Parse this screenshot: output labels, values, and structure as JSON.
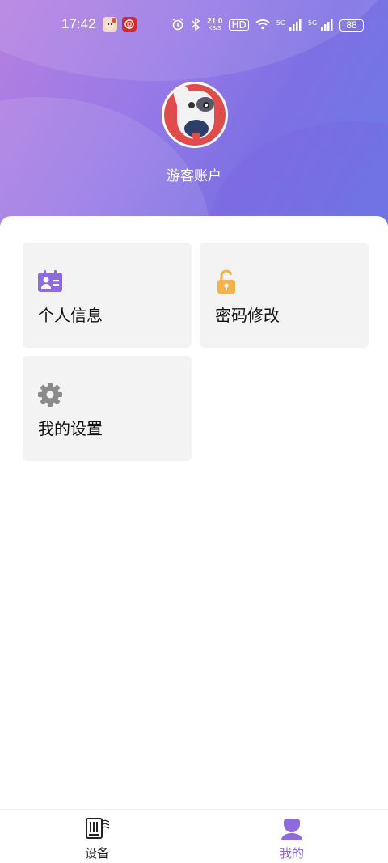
{
  "status_bar": {
    "time": "17:42",
    "net_speed_value": "21.0",
    "net_speed_unit": "KB/S",
    "hd_label": "HD",
    "signal1_label": "5G",
    "signal2_label": "5G",
    "battery": "88"
  },
  "profile": {
    "username": "游客账户"
  },
  "menu": {
    "personal_info": "个人信息",
    "change_password": "密码修改",
    "my_settings": "我的设置"
  },
  "tabbar": {
    "devices": "设备",
    "mine": "我的"
  },
  "colors": {
    "accent": "#8e6ae0",
    "card_bg": "#f3f3f3",
    "lock_orange": "#f5b24b",
    "gear_gray": "#8a8a8a"
  }
}
